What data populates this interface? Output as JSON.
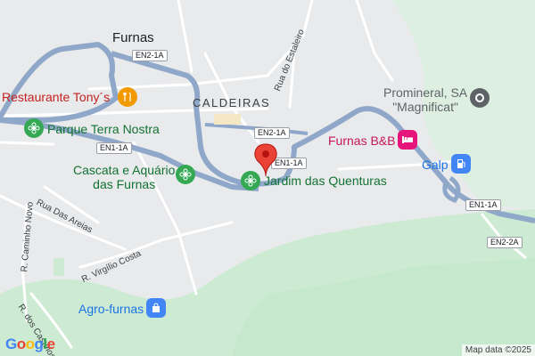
{
  "map": {
    "colors": {
      "background": "#e9eaec",
      "green": "#cdebd2",
      "road_major": "#8fa7c8",
      "road_minor": "#ffffff",
      "pin": "#ea4335"
    },
    "place_labels": {
      "town": "Furnas",
      "district": "CALDEIRAS"
    },
    "pois": {
      "restaurant": "Restaurante Tony´s",
      "park_terra_nostra": "Parque Terra Nostra",
      "cascata_line1": "Cascata e Aquário",
      "cascata_line2": "das Furnas",
      "jardim": "Jardim das Quenturas",
      "promineral_line1": "Promineral, SA",
      "promineral_line2": "\"Magnificat\"",
      "hotel": "Furnas B&B",
      "gas": "Galp",
      "agro": "Agro-furnas"
    },
    "streets": {
      "estaleiro": "Rua do Estaleiro",
      "areias": "Rua Das Areias",
      "virgilio": "R. Virgílio Costa",
      "caminho_novo": "R. Caminho Novo",
      "castelos": "R. dos Castelos"
    },
    "shields": {
      "en2_1a": "EN2-1A",
      "en1_1a": "EN1-1A",
      "en2_2a": "EN2-2A"
    },
    "icons": [
      "fork-knife-icon",
      "flower-icon",
      "pin-icon",
      "hotel-bed-icon",
      "gas-pump-icon",
      "shopping-bag-icon",
      "point-of-interest-icon"
    ],
    "attribution": "Map data ©2025",
    "logo": "Google"
  }
}
